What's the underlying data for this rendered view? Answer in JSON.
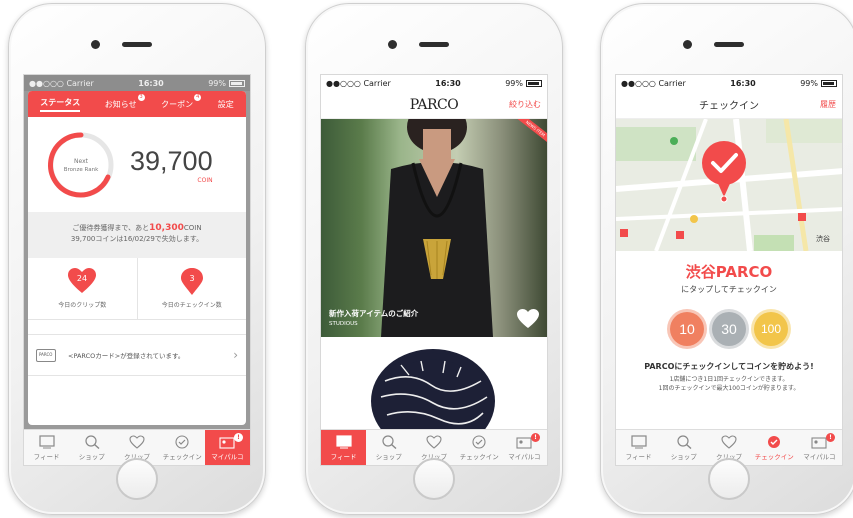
{
  "status": {
    "carrier": "●●○○○ Carrier",
    "time": "16:30",
    "battery": "99%"
  },
  "tabs": {
    "feed": "フィード",
    "shop": "ショップ",
    "clip": "クリップ",
    "checkin": "チェックイン",
    "myparco": "マイパルコ",
    "badge": "!"
  },
  "phone1": {
    "tabs": {
      "status": "ステータス",
      "news": "お知らせ",
      "coupon": "クーポン",
      "settings": "設定",
      "news_badge": "3",
      "coupon_badge": "4"
    },
    "rank_next": "Next",
    "rank_name": "Bronze Rank",
    "coins": "39,700",
    "coin_unit": "COIN",
    "notice_prefix": "ご優待券獲得まで、あと",
    "notice_value": "10,300",
    "notice_suffix": "COIN",
    "notice_line2": "39,700コインは16/02/29で失効します。",
    "clip_count": "24",
    "clip_label": "今日のクリップ数",
    "checkin_count": "3",
    "checkin_label": "今日のチェックイン数",
    "card_icon": "PARCO",
    "card_text": "<PARCOカード>が登録されています。"
  },
  "phone2": {
    "logo": "PARCO",
    "filter": "絞り込む",
    "ribbon": "NEWS ITEM",
    "caption_title": "新作入荷アイテムのご紹介",
    "caption_shop": "STUDIOUS"
  },
  "phone3": {
    "title": "チェックイン",
    "history": "履歴",
    "map_label": "渋谷",
    "place": "渋谷PARCO",
    "instruction": "にタップしてチェックイン",
    "coin1": "10",
    "coin2": "30",
    "coin3": "100",
    "headline": "PARCOにチェックインしてコインを貯めよう!",
    "detail1": "1店舗につき1日1回チェックインできます。",
    "detail2": "1回のチェックインで最大100コインが貯まります。"
  },
  "colors": {
    "accent": "#f24b4b"
  }
}
